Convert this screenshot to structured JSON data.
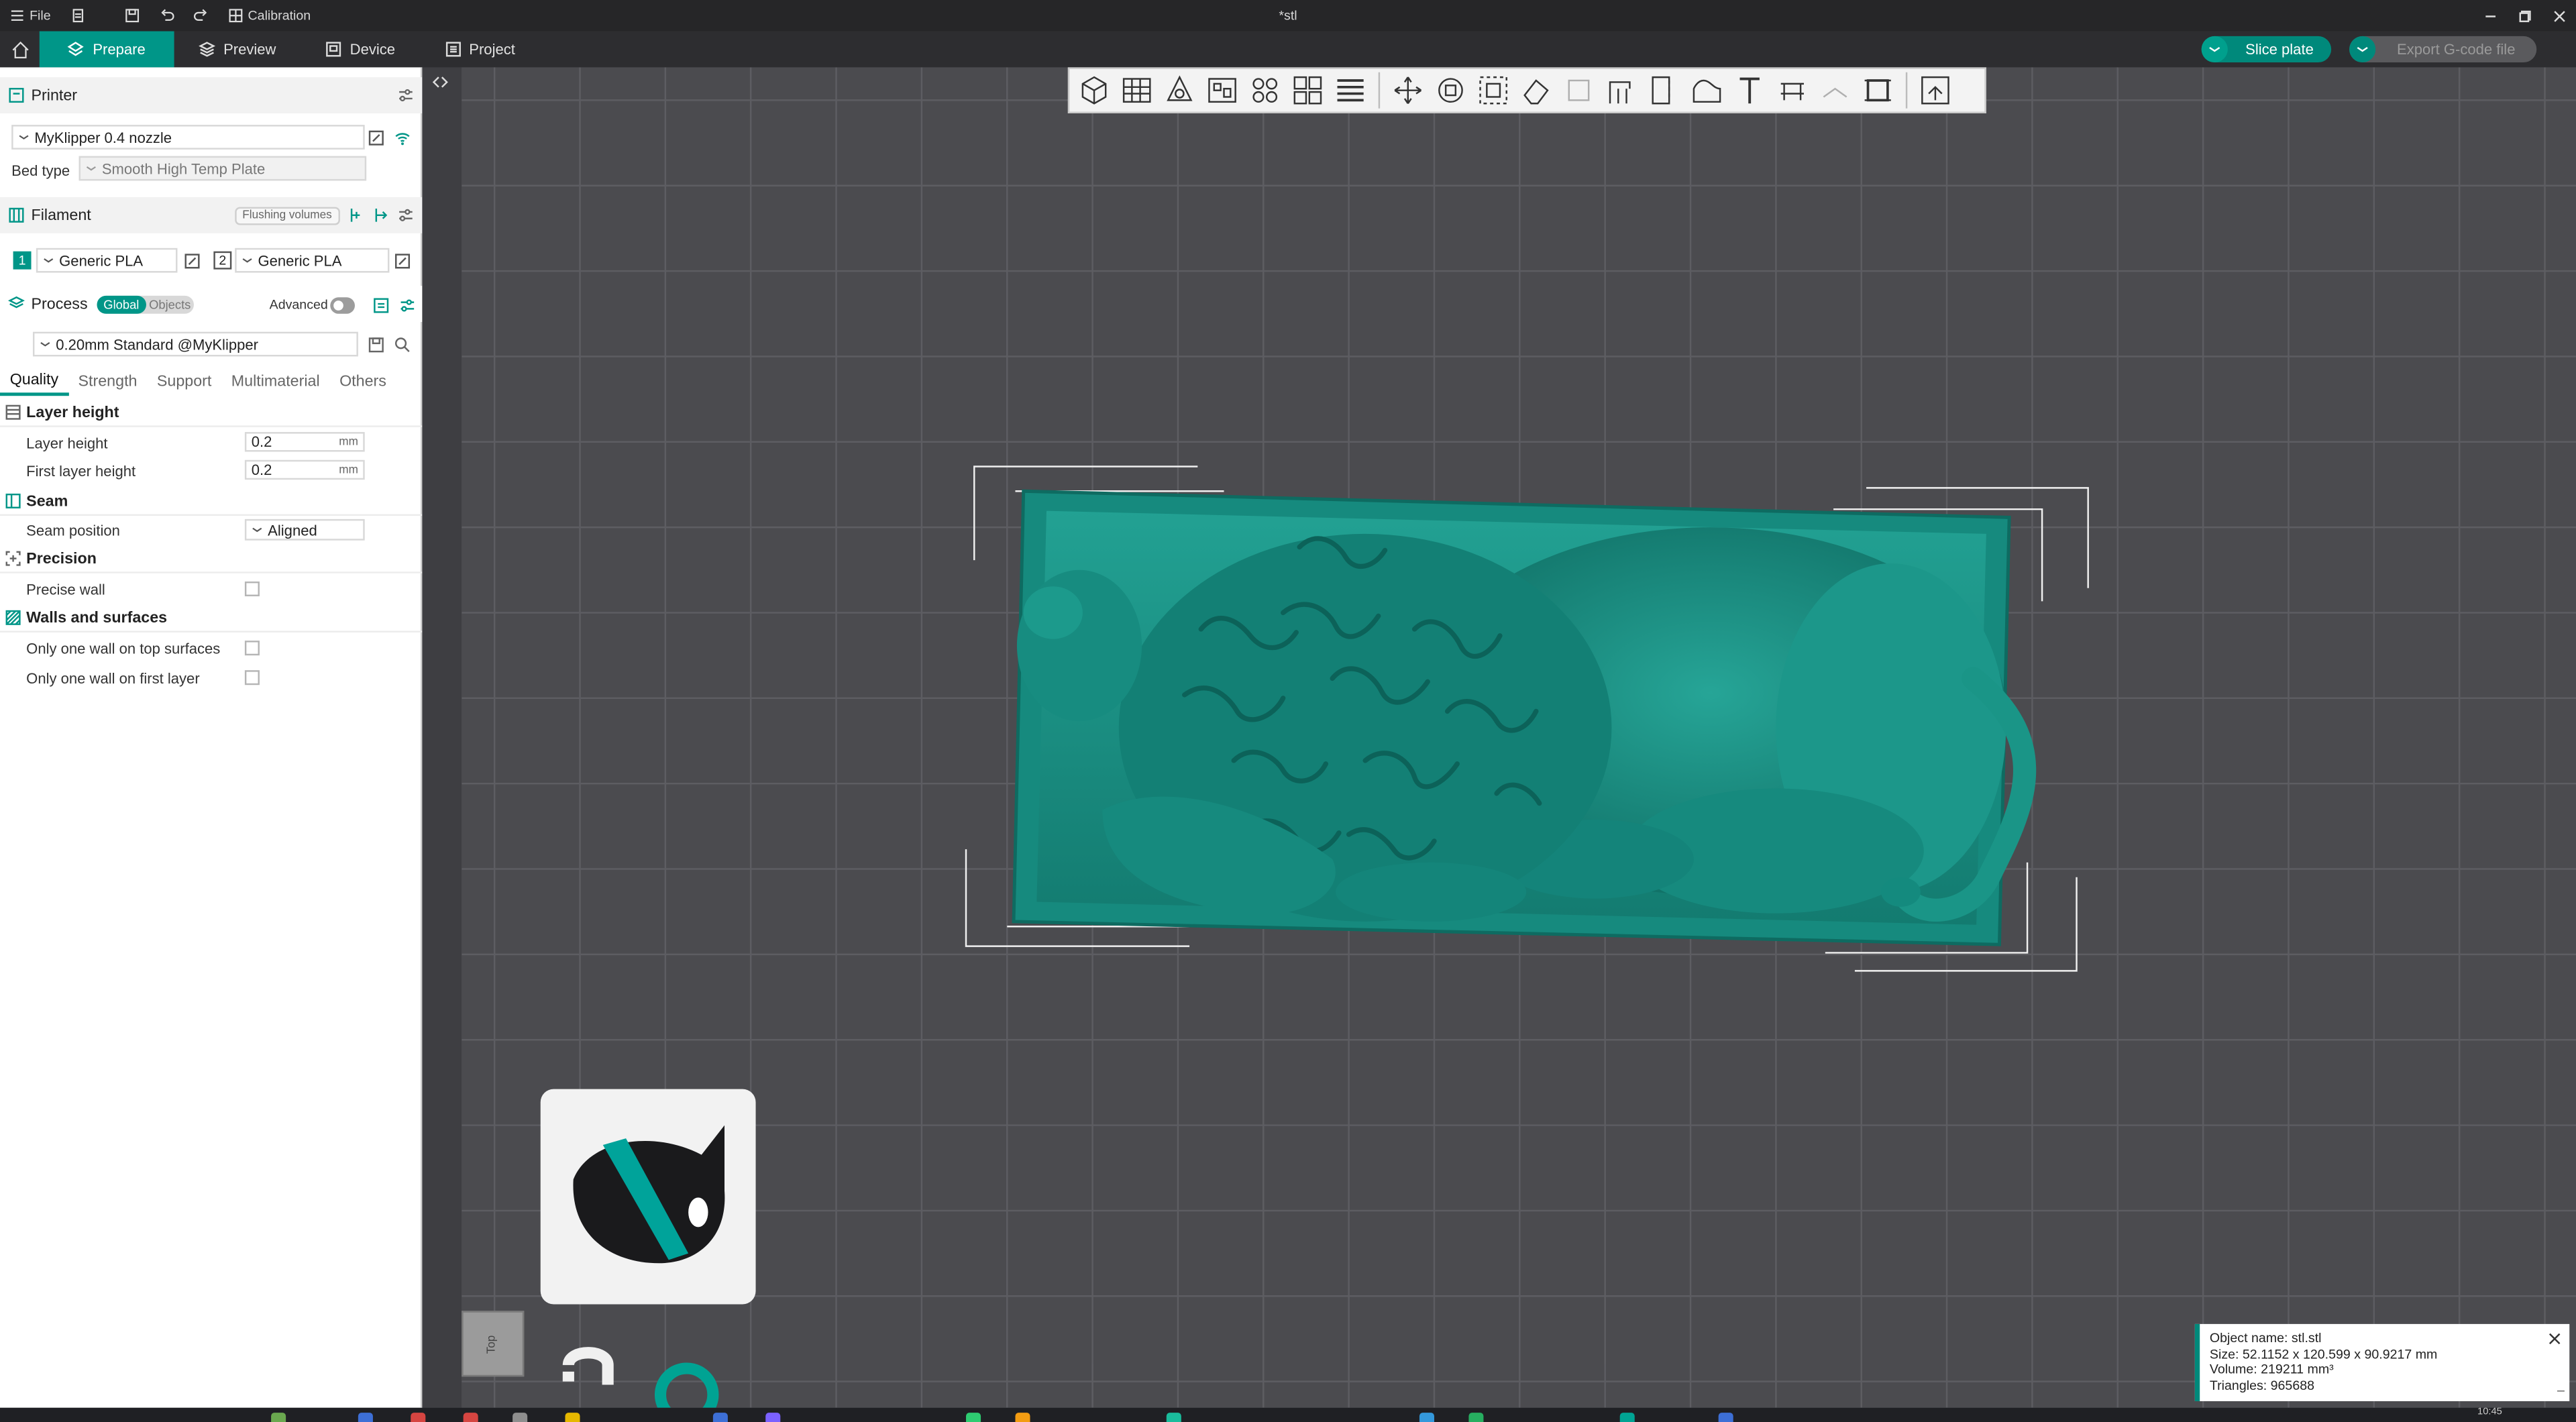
{
  "window": {
    "menu_file": "File",
    "calibration": "Calibration",
    "doc_title": "*stl"
  },
  "nav": {
    "tabs": [
      "Prepare",
      "Preview",
      "Device",
      "Project"
    ],
    "slice_plate": "Slice plate",
    "export_gcode": "Export G-code file"
  },
  "printer": {
    "section": "Printer",
    "name": "MyKlipper 0.4 nozzle",
    "bed_type_label": "Bed type",
    "bed_type_value": "Smooth High Temp Plate"
  },
  "filament": {
    "section": "Filament",
    "flushing": "Flushing volumes",
    "slots": [
      {
        "num": "1",
        "name": "Generic PLA",
        "color": "#009688"
      },
      {
        "num": "2",
        "name": "Generic PLA",
        "color": "#ffffff"
      }
    ]
  },
  "process": {
    "section": "Process",
    "global": "Global",
    "objects": "Objects",
    "advanced": "Advanced",
    "preset": "0.20mm Standard @MyKlipper",
    "tabs": [
      "Quality",
      "Strength",
      "Support",
      "Multimaterial",
      "Others"
    ]
  },
  "settings": {
    "layer_height_group": "Layer height",
    "layer_height_label": "Layer height",
    "layer_height_value": "0.2",
    "first_layer_label": "First layer height",
    "first_layer_value": "0.2",
    "unit": "mm",
    "seam_group": "Seam",
    "seam_position_label": "Seam position",
    "seam_position_value": "Aligned",
    "precision_group": "Precision",
    "precise_wall_label": "Precise wall",
    "walls_group": "Walls and surfaces",
    "one_wall_top": "Only one wall on top surfaces",
    "one_wall_first": "Only one wall on first layer"
  },
  "viewport": {
    "view_cube": "Top"
  },
  "object_info": {
    "name": "Object name: stl.stl",
    "size": "Size: 52.1152 x 120.599 x 90.9217 mm",
    "volume": "Volume: 219211 mm³",
    "triangles": "Triangles: 965688"
  },
  "taskbar": {
    "clock": "10:45"
  },
  "colors": {
    "accent": "#009688",
    "model": "#1e9688",
    "viewport_bg": "#4b4b4f"
  }
}
